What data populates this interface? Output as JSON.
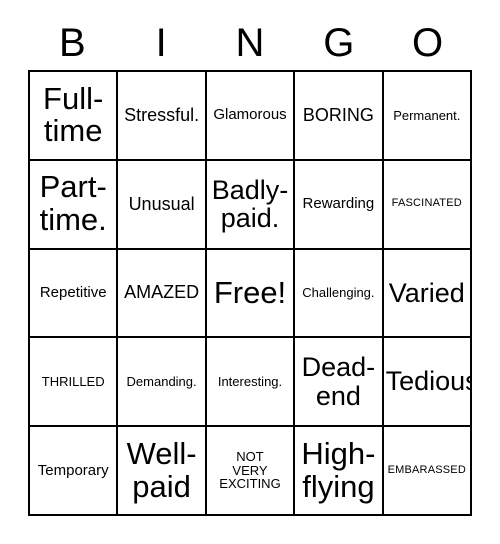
{
  "card": {
    "title": "BINGO",
    "header_letters": [
      "B",
      "I",
      "N",
      "G",
      "O"
    ],
    "colors": {
      "background": "#ffffff",
      "text": "#000000",
      "border": "#000000"
    },
    "rows": [
      [
        {
          "text": "Full-\ntime",
          "size": "fs-huge"
        },
        {
          "text": "Stressful.",
          "size": "fs-lg"
        },
        {
          "text": "Glamorous",
          "size": "fs-md"
        },
        {
          "text": "BORING",
          "size": "fs-lg"
        },
        {
          "text": "Permanent.",
          "size": "fs-sm"
        }
      ],
      [
        {
          "text": "Part-\ntime.",
          "size": "fs-huge"
        },
        {
          "text": "Unusual",
          "size": "fs-lg"
        },
        {
          "text": "Badly-\npaid.",
          "size": "fs-xxl"
        },
        {
          "text": "Rewarding",
          "size": "fs-md"
        },
        {
          "text": "FASCINATED",
          "size": "fs-xs"
        }
      ],
      [
        {
          "text": "Repetitive",
          "size": "fs-md"
        },
        {
          "text": "AMAZED",
          "size": "fs-lg"
        },
        {
          "text": "Free!",
          "size": "fs-huge"
        },
        {
          "text": "Challenging.",
          "size": "fs-sm"
        },
        {
          "text": "Varied",
          "size": "fs-xxl"
        }
      ],
      [
        {
          "text": "THRILLED",
          "size": "fs-sm"
        },
        {
          "text": "Demanding.",
          "size": "fs-sm"
        },
        {
          "text": "Interesting.",
          "size": "fs-sm"
        },
        {
          "text": "Dead-\nend",
          "size": "fs-xxl"
        },
        {
          "text": "Tedious",
          "size": "fs-xxl"
        }
      ],
      [
        {
          "text": "Temporary",
          "size": "fs-md"
        },
        {
          "text": "Well-\npaid",
          "size": "fs-huge"
        },
        {
          "text": "NOT\nVERY\nEXCITING",
          "size": "fs-sm"
        },
        {
          "text": "High-\nflying",
          "size": "fs-huge"
        },
        {
          "text": "EMBARASSED",
          "size": "fs-xs"
        }
      ]
    ]
  }
}
